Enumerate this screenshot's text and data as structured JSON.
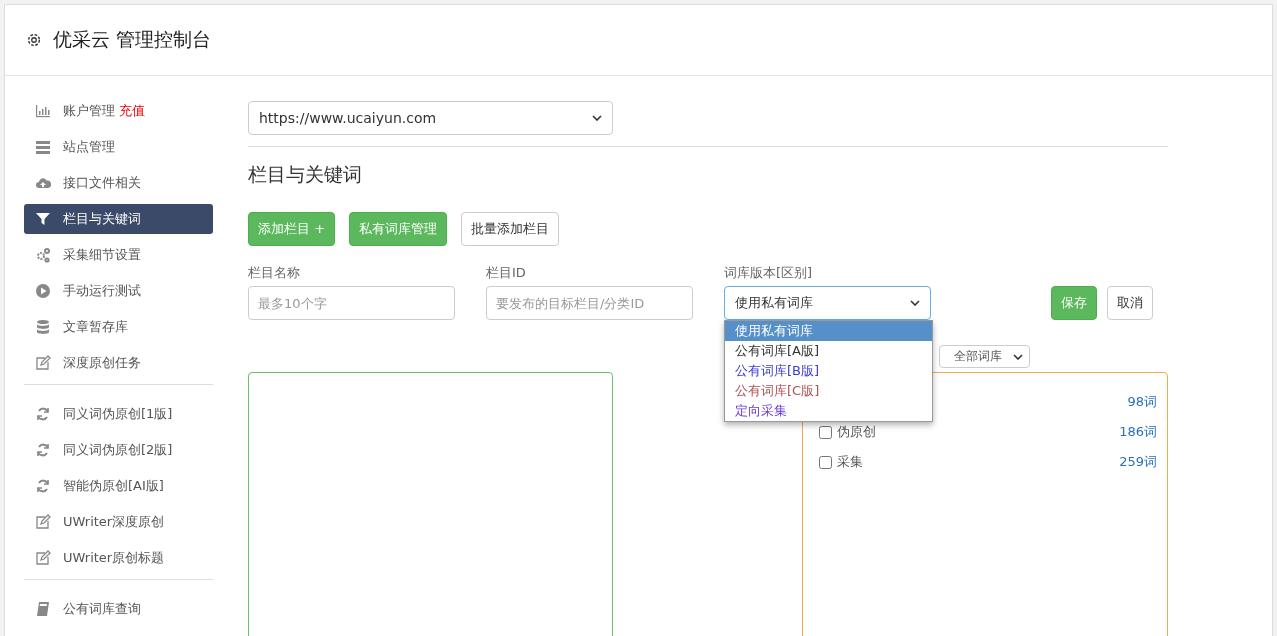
{
  "header": {
    "title": "优采云 管理控制台"
  },
  "sidebar": {
    "groups": [
      [
        {
          "label": "账户管理",
          "badge": "充值",
          "kind": "chart",
          "selected": false
        },
        {
          "label": "站点管理",
          "kind": "server",
          "selected": false
        },
        {
          "label": "接口文件相关",
          "kind": "cloud",
          "selected": false
        },
        {
          "label": "栏目与关键词",
          "kind": "filter",
          "selected": true
        },
        {
          "label": "采集细节设置",
          "kind": "gears",
          "selected": false
        },
        {
          "label": "手动运行测试",
          "kind": "play",
          "selected": false
        },
        {
          "label": "文章暂存库",
          "kind": "database",
          "selected": false
        },
        {
          "label": "深度原创任务",
          "kind": "edit",
          "selected": false
        }
      ],
      [
        {
          "label": "同义词伪原创[1版]",
          "kind": "refresh",
          "selected": false
        },
        {
          "label": "同义词伪原创[2版]",
          "kind": "refresh",
          "selected": false
        },
        {
          "label": "智能伪原创[AI版]",
          "kind": "refresh",
          "selected": false
        },
        {
          "label": "UWriter深度原创",
          "kind": "edit",
          "selected": false
        },
        {
          "label": "UWriter原创标题",
          "kind": "edit",
          "selected": false
        }
      ],
      [
        {
          "label": "公有词库查询",
          "kind": "book",
          "selected": false
        }
      ]
    ]
  },
  "site_select": {
    "value": "https://www.ucaiyun.com"
  },
  "section_title": "栏目与关键词",
  "toolbar": [
    {
      "label": "添加栏目 +",
      "kind": "primary"
    },
    {
      "label": "私有词库管理",
      "kind": "primary"
    },
    {
      "label": "批量添加栏目",
      "kind": "default"
    }
  ],
  "form": {
    "fields": [
      {
        "label": "栏目名称",
        "placeholder": "最多10个字"
      },
      {
        "label": "栏目ID",
        "placeholder": "要发布的目标栏目/分类ID"
      }
    ],
    "library": {
      "label": "词库版本[区别]",
      "value": "使用私有词库",
      "expanded": true,
      "options": [
        {
          "label": "使用私有词库",
          "selected": true
        },
        {
          "label": "公有词库[A版]",
          "selected": false,
          "color": "#333333"
        },
        {
          "label": "公有词库[B版]",
          "selected": false,
          "color": "#3b3bd6"
        },
        {
          "label": "公有词库[C版]",
          "selected": false,
          "color": "#b05050"
        },
        {
          "label": "定向采集",
          "selected": false,
          "color": "#6a3bd6"
        }
      ]
    },
    "save": "保存",
    "cancel": "取消"
  },
  "filter_select": {
    "value": "全部词库"
  },
  "word_lists": [
    {
      "count": "98词"
    },
    {
      "label": "伪原创",
      "count": "186词",
      "checked": false
    },
    {
      "label": "采集",
      "count": "259词",
      "checked": false
    }
  ]
}
